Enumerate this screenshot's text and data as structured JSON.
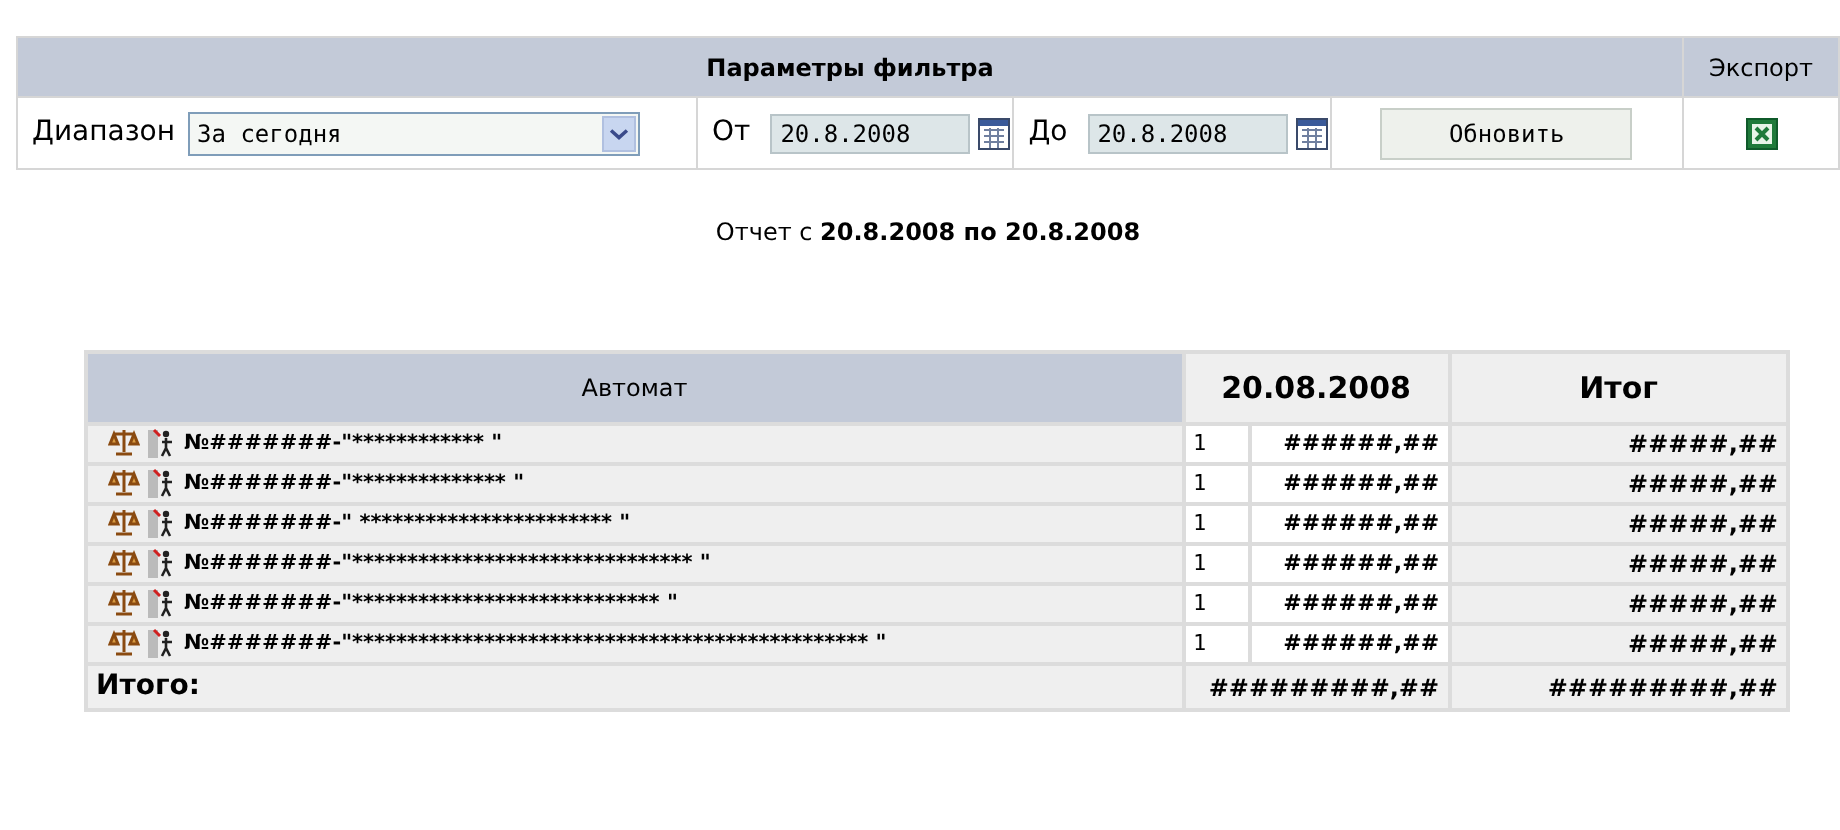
{
  "filter": {
    "title": "Параметры фильтра",
    "export_title": "Экспорт",
    "range_label": "Диапазон",
    "range_value": "За сегодня",
    "from_label": "От",
    "from_value": "20.8.2008",
    "to_label": "До",
    "to_value": "20.8.2008",
    "refresh_button": "Обновить"
  },
  "report_caption": "Отчет с **20.8.2008 по 20.8.2008**",
  "table": {
    "columns": [
      "Автомат",
      "20.08.2008",
      "Итог"
    ],
    "rows": [
      {
        "name": "№#######-\"************ \"",
        "count": "1",
        "amount": "######,##",
        "total": "#####,##"
      },
      {
        "name": "№#######-\"************** \"",
        "count": "1",
        "amount": "######,##",
        "total": "#####,##"
      },
      {
        "name": "№#######-\" *********************** \"",
        "count": "1",
        "amount": "######,##",
        "total": "#####,##"
      },
      {
        "name": "№#######-\"******************************* \"",
        "count": "1",
        "amount": "######,##",
        "total": "#####,##"
      },
      {
        "name": "№#######-\"**************************** \"",
        "count": "1",
        "amount": "######,##",
        "total": "#####,##"
      },
      {
        "name": "№#######-\"*********************************************** \"",
        "count": "1",
        "amount": "######,##",
        "total": "#####,##"
      }
    ],
    "totals": {
      "label": "Итого:",
      "day_total": "#########,##",
      "grand_total": "#########,##"
    }
  }
}
